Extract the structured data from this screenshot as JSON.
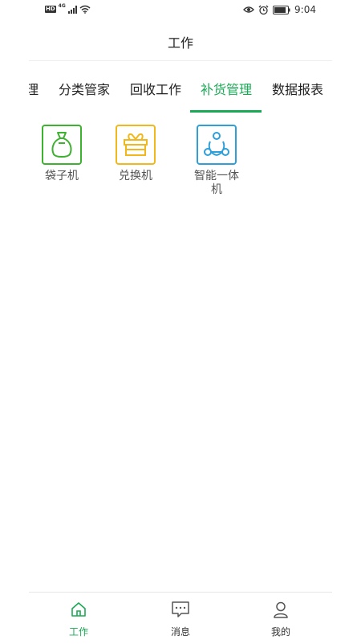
{
  "status_bar": {
    "left_icons": [
      "hd-icon",
      "signal-4g-icon",
      "wifi-icon"
    ],
    "hd": "HD",
    "network": "4G",
    "right_icons": [
      "eye-icon",
      "alarm-icon",
      "battery-icon"
    ],
    "time": "9:04"
  },
  "header": {
    "title": "工作"
  },
  "tabs": [
    {
      "label": "理",
      "active": false
    },
    {
      "label": "分类管家",
      "active": false
    },
    {
      "label": "回收工作",
      "active": false
    },
    {
      "label": "补货管理",
      "active": true
    },
    {
      "label": "数据报表",
      "active": false
    }
  ],
  "grid": [
    {
      "label": "袋子机",
      "icon": "bag-icon",
      "color": "#3db22f"
    },
    {
      "label": "兑换机",
      "icon": "gift-box-icon",
      "color": "#f0b81c"
    },
    {
      "label": "智能一体机",
      "icon": "share-nodes-icon",
      "color": "#2e9fd8"
    }
  ],
  "bottom_nav": [
    {
      "label": "工作",
      "icon": "home-icon",
      "active": true
    },
    {
      "label": "消息",
      "icon": "message-icon",
      "active": false
    },
    {
      "label": "我的",
      "icon": "user-icon",
      "active": false
    }
  ],
  "colors": {
    "accent": "#1aaa55",
    "divider": "#eeeeee"
  }
}
